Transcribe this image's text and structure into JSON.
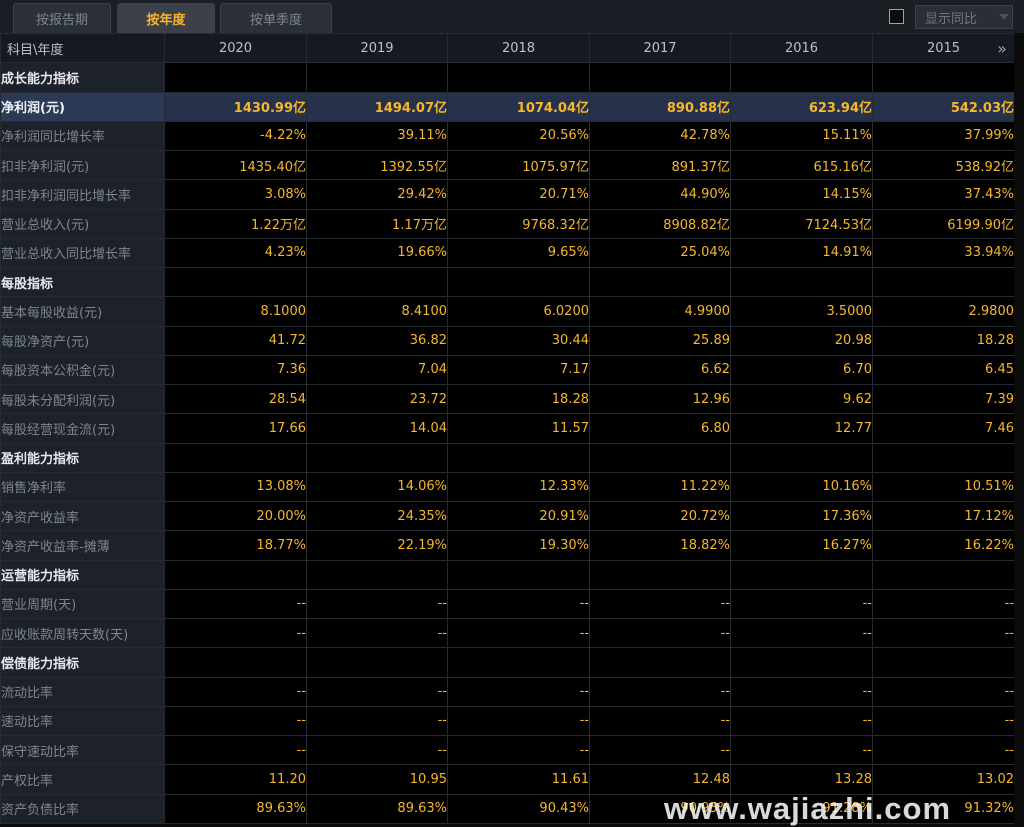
{
  "tabs": [
    {
      "label": "按报告期",
      "active": false
    },
    {
      "label": "按年度",
      "active": true
    },
    {
      "label": "按单季度",
      "active": false
    }
  ],
  "yoy_toggle": {
    "label": "显示同比",
    "checked": false
  },
  "header": {
    "first": "科目\\年度",
    "years": [
      "2020",
      "2019",
      "2018",
      "2017",
      "2016",
      "2015"
    ],
    "more_icon": "double-chevron-right-icon"
  },
  "rows": [
    {
      "label": "成长能力指标",
      "type": "section"
    },
    {
      "label": "净利润(元)",
      "type": "highlight",
      "values": [
        "1430.99亿",
        "1494.07亿",
        "1074.04亿",
        "890.88亿",
        "623.94亿",
        "542.03亿"
      ]
    },
    {
      "label": "净利润同比增长率",
      "values": [
        "-4.22%",
        "39.11%",
        "20.56%",
        "42.78%",
        "15.11%",
        "37.99%"
      ]
    },
    {
      "label": "扣非净利润(元)",
      "values": [
        "1435.40亿",
        "1392.55亿",
        "1075.97亿",
        "891.37亿",
        "615.16亿",
        "538.92亿"
      ]
    },
    {
      "label": "扣非净利润同比增长率",
      "values": [
        "3.08%",
        "29.42%",
        "20.71%",
        "44.90%",
        "14.15%",
        "37.43%"
      ]
    },
    {
      "label": "营业总收入(元)",
      "values": [
        "1.22万亿",
        "1.17万亿",
        "9768.32亿",
        "8908.82亿",
        "7124.53亿",
        "6199.90亿"
      ]
    },
    {
      "label": "营业总收入同比增长率",
      "values": [
        "4.23%",
        "19.66%",
        "9.65%",
        "25.04%",
        "14.91%",
        "33.94%"
      ]
    },
    {
      "label": "每股指标",
      "type": "section"
    },
    {
      "label": "基本每股收益(元)",
      "values": [
        "8.1000",
        "8.4100",
        "6.0200",
        "4.9900",
        "3.5000",
        "2.9800"
      ]
    },
    {
      "label": "每股净资产(元)",
      "values": [
        "41.72",
        "36.82",
        "30.44",
        "25.89",
        "20.98",
        "18.28"
      ]
    },
    {
      "label": "每股资本公积金(元)",
      "values": [
        "7.36",
        "7.04",
        "7.17",
        "6.62",
        "6.70",
        "6.45"
      ]
    },
    {
      "label": "每股未分配利润(元)",
      "values": [
        "28.54",
        "23.72",
        "18.28",
        "12.96",
        "9.62",
        "7.39"
      ]
    },
    {
      "label": "每股经营现金流(元)",
      "values": [
        "17.66",
        "14.04",
        "11.57",
        "6.80",
        "12.77",
        "7.46"
      ]
    },
    {
      "label": "盈利能力指标",
      "type": "section"
    },
    {
      "label": "销售净利率",
      "values": [
        "13.08%",
        "14.06%",
        "12.33%",
        "11.22%",
        "10.16%",
        "10.51%"
      ]
    },
    {
      "label": "净资产收益率",
      "values": [
        "20.00%",
        "24.35%",
        "20.91%",
        "20.72%",
        "17.36%",
        "17.12%"
      ]
    },
    {
      "label": "净资产收益率-摊薄",
      "values": [
        "18.77%",
        "22.19%",
        "19.30%",
        "18.82%",
        "16.27%",
        "16.22%"
      ]
    },
    {
      "label": "运营能力指标",
      "type": "section"
    },
    {
      "label": "营业周期(天)",
      "values": [
        "--",
        "--",
        "--",
        "--",
        "--",
        "--"
      ]
    },
    {
      "label": "应收账款周转天数(天)",
      "values": [
        "--",
        "--",
        "--",
        "--",
        "--",
        "--"
      ]
    },
    {
      "label": "偿债能力指标",
      "type": "section"
    },
    {
      "label": "流动比率",
      "values": [
        "--",
        "--",
        "--",
        "--",
        "--",
        "--"
      ]
    },
    {
      "label": "速动比率",
      "values": [
        "--",
        "--",
        "--",
        "--",
        "--",
        "--"
      ]
    },
    {
      "label": "保守速动比率",
      "values": [
        "--",
        "--",
        "--",
        "--",
        "--",
        "--"
      ]
    },
    {
      "label": "产权比率",
      "values": [
        "11.20",
        "10.95",
        "11.61",
        "12.48",
        "13.28",
        "13.02"
      ]
    },
    {
      "label": "资产负债比率",
      "values": [
        "89.63%",
        "89.63%",
        "90.43%",
        "90.95%",
        "91.28%",
        "91.32%"
      ]
    }
  ],
  "watermark": "www.wajiazhi.com",
  "colors": {
    "accent": "#f6b72b",
    "highlight_row": "#26324b",
    "label_bg": "#1d2129"
  }
}
